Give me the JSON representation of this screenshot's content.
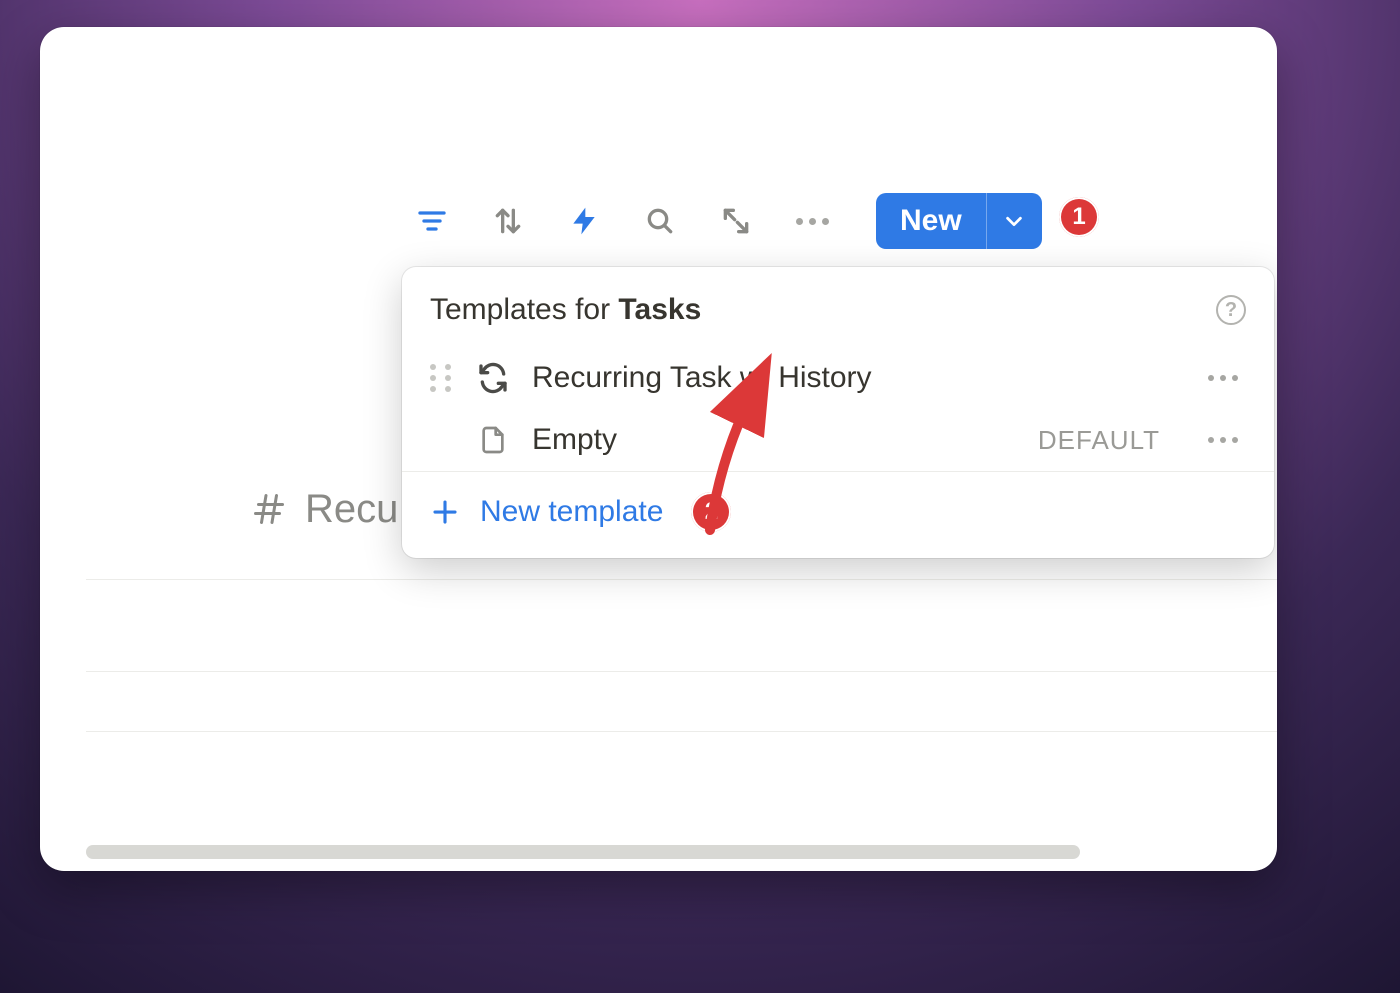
{
  "toolbar": {
    "new_label": "New"
  },
  "popover": {
    "title_prefix": "Templates for",
    "title_target": "Tasks",
    "items": [
      {
        "name": "Recurring Task w/ History",
        "is_default": false,
        "icon": "recurring"
      },
      {
        "name": "Empty",
        "is_default": true,
        "icon": "page"
      }
    ],
    "default_tag": "DEFAULT",
    "new_template_label": "New template"
  },
  "background": {
    "partial_text": "Recu"
  },
  "annotations": {
    "dot1": "1",
    "dot2": "2"
  }
}
